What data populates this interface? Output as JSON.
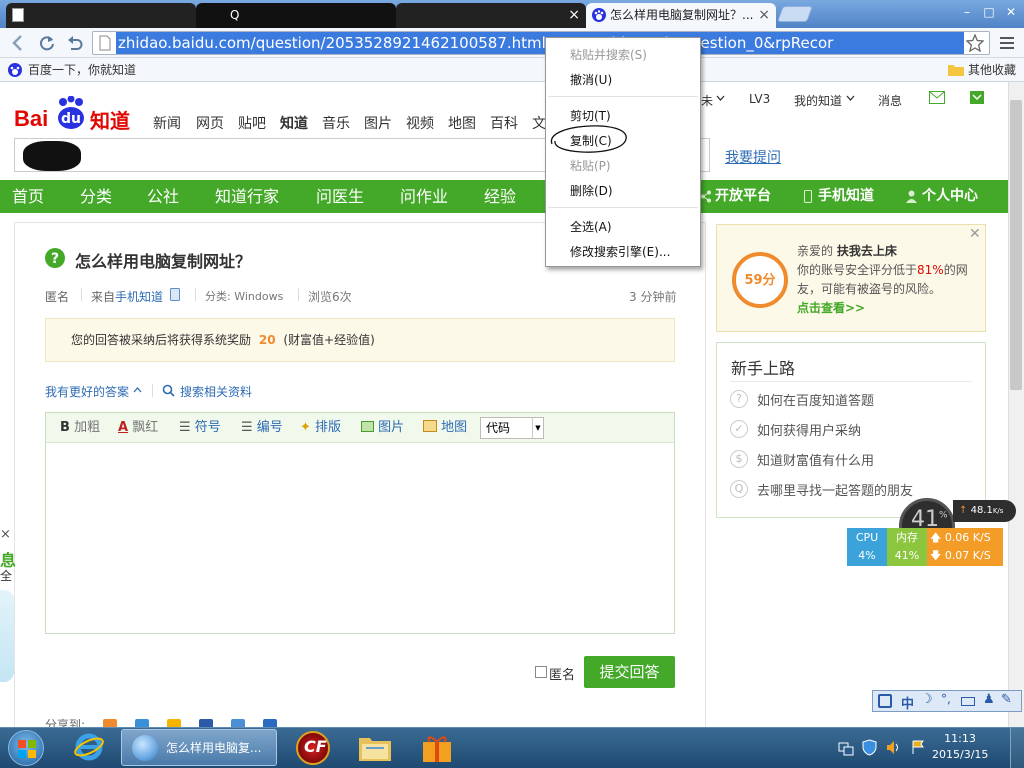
{
  "tabs": [
    {
      "label": ""
    },
    {
      "label": "Q"
    },
    {
      "label": ""
    },
    {
      "label": "怎么样用电脑复制网址？..."
    }
  ],
  "tab_close": "×",
  "window_controls": {
    "minimize": "–",
    "restore": "□",
    "close": "✕"
  },
  "url": "zhidao.baidu.com/question/2053528921462100587.html?...=3&qbl=push_question_0&rpRecor",
  "bookmarks": {
    "left": "百度一下，你就知道",
    "right": "其他收藏"
  },
  "site": {
    "logo_bai": "Bai",
    "logo_du": "du",
    "logo_zhidao": "知道",
    "top_nav": [
      "新闻",
      "网页",
      "贴吧",
      "知道",
      "音乐",
      "图片",
      "视频",
      "地图",
      "百科",
      "文"
    ],
    "user_bar": {
      "partial": "未",
      "level": "LV3",
      "my_zhidao": "我的知道",
      "messages": "消息"
    },
    "ask_link": "我要提问"
  },
  "green_nav": {
    "left": [
      "首页",
      "分类",
      "公社",
      "知道行家",
      "问医生",
      "问作业",
      "经验"
    ],
    "right": [
      "开放平台",
      "手机知道",
      "个人中心"
    ]
  },
  "question": {
    "title": "怎么样用电脑复制网址？",
    "meta_anon": "匿名",
    "meta_from_prefix": "来自",
    "meta_from_link": "手机知道",
    "meta_category": "分类: Windows",
    "meta_views": "浏览6次",
    "meta_time": "3 分钟前"
  },
  "reward": {
    "prefix": "您的回答被采纳后将获得系统奖励",
    "amount": "20",
    "suffix": "(财富值+经验值)"
  },
  "answer_links": {
    "better": "我有更好的答案",
    "search": "搜索相关资料"
  },
  "editor_toolbar": {
    "bold": "加粗",
    "red": "飘红",
    "symbol": "符号",
    "number": "编号",
    "layout": "排版",
    "image": "图片",
    "map": "地图",
    "code": "代码"
  },
  "submit": {
    "anon_label": "匿名",
    "button": "提交回答"
  },
  "share_label": "分享到:",
  "security": {
    "score": "59分",
    "greeting": "亲爱的",
    "username": "扶我去上床",
    "line1a": "你的账号安全评分低于",
    "percent": "81%",
    "line1b": "的网",
    "line2": "友，可能有被盗号的风险。",
    "link": "点击查看>>"
  },
  "newbie": {
    "title": "新手上路",
    "items": [
      "如何在百度知道答题",
      "如何获得用户采纳",
      "知道财富值有什么用",
      "去哪里寻找一起答题的朋友"
    ]
  },
  "context_menu": [
    {
      "label": "粘贴并搜索(S)",
      "enabled": false
    },
    {
      "label": "撤消(U)",
      "enabled": true
    },
    {
      "label": "剪切(T)",
      "enabled": true
    },
    {
      "label": "复制(C)",
      "enabled": true
    },
    {
      "label": "粘贴(P)",
      "enabled": false
    },
    {
      "label": "删除(D)",
      "enabled": true
    },
    {
      "label": "全选(A)",
      "enabled": true
    },
    {
      "label": "修改搜索引擎(E)...",
      "enabled": true
    }
  ],
  "net_widget": {
    "percent": "41",
    "percent_sign": "%",
    "speed_top": "48.1",
    "speed_top_unit": "K/s",
    "cpu_label": "CPU",
    "cpu_value": "4%",
    "mem_label": "内存",
    "mem_value": "41%",
    "up": "0.06 K/S",
    "down": "0.07 K/S"
  },
  "side_ad": {
    "x": "×",
    "line1": "息",
    "line2": "全"
  },
  "ime": {
    "mode": "中"
  },
  "taskbar": {
    "active_window": "怎么样用电脑复..."
  },
  "clock": {
    "time": "11:13",
    "date": "2015/3/15"
  },
  "colors": {
    "brand_green": "#44a928",
    "baidu_red": "#e10602",
    "baidu_blue": "#2932e1",
    "link_blue": "#2e6cb5",
    "warn_orange": "#f08b2d"
  }
}
